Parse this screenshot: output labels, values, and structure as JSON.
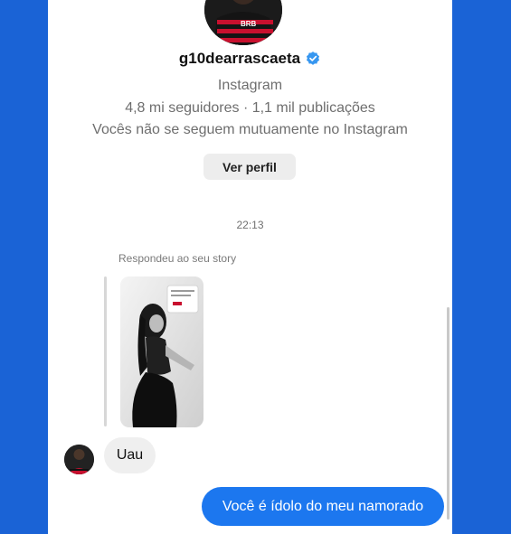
{
  "profile": {
    "username": "g10dearrascaeta",
    "platform": "Instagram",
    "stats": "4,8 mi seguidores · 1,1 mil publicações",
    "mutual": "Vocês não se seguem mutuamente no Instagram",
    "view_profile_label": "Ver perfil",
    "verified_color": "#3797f0"
  },
  "chat": {
    "timestamp": "22:13",
    "story_reply_label": "Respondeu ao seu story",
    "messages": [
      {
        "from": "them",
        "text": "Uau"
      },
      {
        "from": "me",
        "text": "Você é ídolo do meu namorado"
      }
    ]
  },
  "colors": {
    "background": "#1a63d6",
    "outgoing_bubble": "#1c77ef",
    "incoming_bubble": "#efefef"
  }
}
